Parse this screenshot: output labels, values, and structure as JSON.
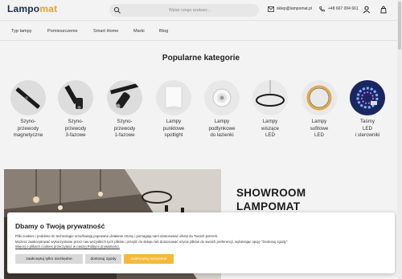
{
  "header": {
    "logo_main": "Lampo",
    "logo_accent": "mat",
    "search_placeholder": "Wpisz czego szukasz...",
    "email": "sklep@lampomat.pl",
    "phone": "+48 667 004 661"
  },
  "nav": {
    "items": [
      "Typ lampy",
      "Pomieszczenie",
      "Smart Home",
      "Marki",
      "Blog"
    ]
  },
  "categories": {
    "title": "Popularne kategorie",
    "items": [
      {
        "lines": [
          "Szyno-",
          "przewody",
          "magnetyczne"
        ]
      },
      {
        "lines": [
          "Szyno-",
          "przewody",
          "3-fazowe"
        ]
      },
      {
        "lines": [
          "Szyno-",
          "przewody",
          "1-fazowe"
        ]
      },
      {
        "lines": [
          "Lampy",
          "punktowe",
          "spotlight"
        ]
      },
      {
        "lines": [
          "Lampy",
          "podtynkowe",
          "do łazienki"
        ]
      },
      {
        "lines": [
          "Lampy",
          "wiszące",
          "LED"
        ]
      },
      {
        "lines": [
          "Lampy",
          "sufitowe",
          "LED"
        ]
      },
      {
        "lines": [
          "Taśmy",
          "LED",
          "i sterowniki"
        ]
      }
    ]
  },
  "showroom": {
    "title_line1": "SHOWROOM",
    "title_line2": "LAMPOMAT"
  },
  "cookie": {
    "title": "Dbamy o Twoją prywatność",
    "text_line1": "Pliki cookies i podobne im technologie umożliwiają poprawne działanie strony i pomagają nam dostosować ofertę do Twoich potrzeb.",
    "text_line2": "Możesz zaakceptować wykorzystanie przez nas wszystkich tych plików i przejść do sklepu lub dostosować użycie plików do swoich preferencji, wybierając opcję \"Dostosuj zgody\".",
    "link": "Więcej o plikach cookies przeczytasz w naszej Polityce prywatności.",
    "btn_necessary": "zaakceptuj tylko niezbędne",
    "btn_customize": "dostosuj zgody",
    "btn_accept_all": "zaakceptuj wszystkie"
  },
  "colors": {
    "accent": "#f5b93a",
    "brand": "#1e2b4a"
  }
}
